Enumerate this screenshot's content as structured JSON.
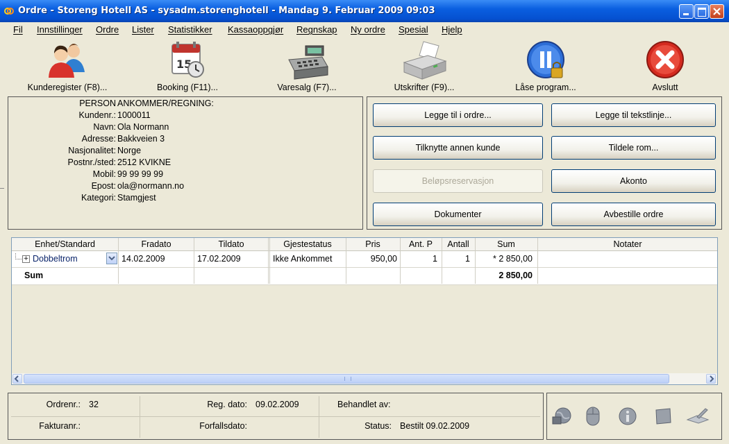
{
  "window": {
    "title": "Ordre - Storeng Hotell AS - sysadm.storenghotell - Mandag 9. Februar 2009 09:03"
  },
  "menu": [
    "Fil",
    "Innstillinger",
    "Ordre",
    "Lister",
    "Statistikker",
    "Kassaoppgjør",
    "Regnskap",
    "Ny ordre",
    "Spesial",
    "Hjelp"
  ],
  "toolbar": {
    "customers": "Kunderegister (F8)...",
    "booking": "Booking (F11)...",
    "sales": "Varesalg (F7)...",
    "prints": "Utskrifter (F9)...",
    "lock": "Låse program...",
    "exit": "Avslutt"
  },
  "person": {
    "header_label": "PERSON",
    "header_value": "ANKOMMER/REGNING:",
    "rows": [
      {
        "label": "Kundenr.:",
        "value": "1000011"
      },
      {
        "label": "Navn:",
        "value": "Ola Normann"
      },
      {
        "label": "Adresse:",
        "value": "Bakkveien 3"
      },
      {
        "label": "Nasjonalitet:",
        "value": "Norge"
      },
      {
        "label": "Postnr./sted:",
        "value": "2512 KVIKNE"
      },
      {
        "label": "Mobil:",
        "value": "99 99 99 99"
      },
      {
        "label": "Epost:",
        "value": "ola@normann.no"
      },
      {
        "label": "Kategori:",
        "value": "Stamgjest"
      }
    ]
  },
  "actions": {
    "add_to_order": "Legge til i ordre...",
    "add_text_line": "Legge til tekstlinje...",
    "link_customer": "Tilknytte annen kunde",
    "assign_room": "Tildele rom...",
    "amount_reservation": "Beløpsreservasjon",
    "on_account": "Akonto",
    "documents": "Dokumenter",
    "cancel_order": "Avbestille ordre"
  },
  "grid": {
    "columns": [
      "Enhet/Standard",
      "Fradato",
      "Tildato",
      "Gjestestatus",
      "Pris",
      "Ant. P",
      "Antall",
      "Sum",
      "Notater"
    ],
    "rows": [
      {
        "unit": "Dobbeltrom",
        "from": "14.02.2009",
        "to": "17.02.2009",
        "status": "Ikke Ankommet",
        "price": "950,00",
        "persons": "1",
        "qty": "1",
        "sum": "* 2 850,00",
        "notes": ""
      }
    ],
    "sum_label": "Sum",
    "sum_value": "2 850,00"
  },
  "status": {
    "order_no_label": "Ordrenr.:",
    "order_no": "32",
    "reg_date_label": "Reg. dato:",
    "reg_date": "09.02.2009",
    "handled_by_label": "Behandlet av:",
    "handled_by": "",
    "invoice_no_label": "Fakturanr.:",
    "invoice_no": "",
    "due_date_label": "Forfallsdato:",
    "due_date": "",
    "status_label": "Status:",
    "status_value": "Bestilt 09.02.2009"
  },
  "colors": {
    "titlebar": "#0A5FE0",
    "face": "#ECE9D8",
    "selected_text": "#0A246A",
    "exit_red": "#D42A1F"
  },
  "icons": [
    "people-icon",
    "calendar-clock-icon",
    "cash-register-icon",
    "printer-icon",
    "pause-lock-icon",
    "close-x-icon",
    "globe-icon",
    "mouse-icon",
    "info-icon",
    "note-icon",
    "book-pen-icon"
  ]
}
